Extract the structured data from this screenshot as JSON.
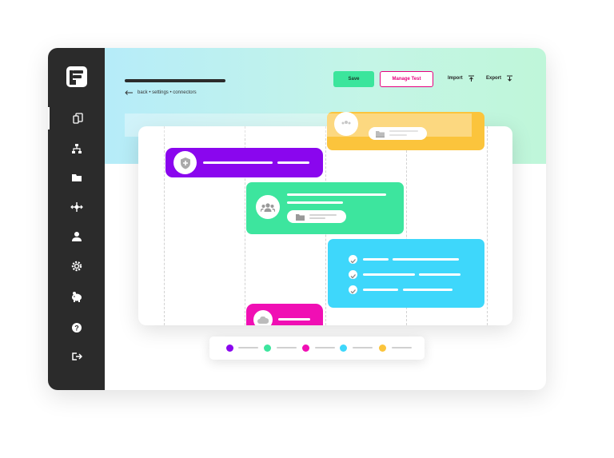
{
  "header": {
    "breadcrumb": "back • settings • connectors",
    "save_label": "Save",
    "manage_label": "Manage Test",
    "import_label": "Import",
    "export_label": "Export"
  },
  "sidebar": {
    "icons": [
      "devices-icon",
      "hierarchy-icon",
      "folder-icon",
      "integrations-icon",
      "user-icon",
      "settings-icon",
      "piggy-bank-icon",
      "help-icon",
      "logout-icon"
    ]
  },
  "colors": {
    "purple": "#8a06ee",
    "green": "#3de59e",
    "magenta": "#f00fb4",
    "cyan": "#3ed7fb",
    "yellow": "#fbc43c",
    "sidebar": "#2b2b2b"
  },
  "legend": [
    "purple",
    "green",
    "magenta",
    "cyan",
    "yellow"
  ]
}
